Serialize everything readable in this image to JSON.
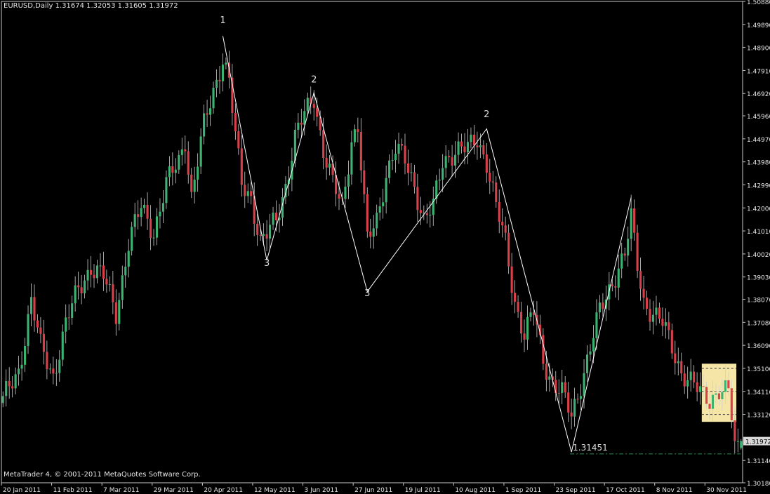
{
  "window": {
    "header": "EURUSD,Daily  1.31674 1.32053 1.31605 1.31972",
    "copyright": "MetaTrader 4, © 2001-2011 MetaQuotes Software Corp."
  },
  "colors": {
    "background": "#000000",
    "frame": "#c8c8c8",
    "text": "#e6e6e6",
    "bull_candle": "#3cb371",
    "bear_candle": "#d9404a",
    "wick": "#d0d0d0",
    "wave_line": "#ffffff",
    "highlight_box": "#f5e6a8",
    "support_line": "#2e8b57"
  },
  "chart_data": {
    "type": "candlestick",
    "symbol": "EURUSD",
    "timeframe": "Daily",
    "last_bar": {
      "open": 1.31674,
      "high": 1.32053,
      "low": 1.31605,
      "close": 1.31972
    },
    "current_price_label": "1.31972",
    "ylim": [
      1.3018,
      1.5088
    ],
    "y_ticks": [
      "1.50880",
      "1.49890",
      "1.48900",
      "1.47910",
      "1.46920",
      "1.45960",
      "1.44970",
      "1.43980",
      "1.42990",
      "1.42000",
      "1.41010",
      "1.40020",
      "1.39030",
      "1.38070",
      "1.37080",
      "1.36090",
      "1.35100",
      "1.34110",
      "1.33120",
      "1.31140",
      "1.30180"
    ],
    "x_ticks": [
      "20 Jan 2011",
      "11 Feb 2011",
      "7 Mar 2011",
      "29 Mar 2011",
      "20 Apr 2011",
      "12 May 2011",
      "3 Jun 2011",
      "27 Jun 2011",
      "19 Jul 2011",
      "10 Aug 2011",
      "1 Sep 2011",
      "23 Sep 2011",
      "17 Oct 2011",
      "8 Nov 2011",
      "30 Nov 2011"
    ],
    "x_tick_bar_index": [
      0,
      16,
      32,
      48,
      64,
      80,
      96,
      112,
      128,
      144,
      160,
      176,
      192,
      208,
      224
    ],
    "wave_lines": [
      {
        "points": [
          [
            70,
            1.4939
          ],
          [
            84,
            1.3975
          ],
          [
            99,
            1.4695
          ],
          [
            116,
            1.384
          ],
          [
            154,
            1.454
          ],
          [
            181,
            1.315
          ],
          [
            200,
            1.4245
          ]
        ]
      }
    ],
    "wave_labels": [
      {
        "text": "1",
        "bar": 70,
        "price": 1.4995
      },
      {
        "text": "2",
        "bar": 99,
        "price": 1.474
      },
      {
        "text": "3",
        "bar": 84,
        "price": 1.395
      },
      {
        "text": "3",
        "bar": 116,
        "price": 1.382
      },
      {
        "text": "2",
        "bar": 154,
        "price": 1.459
      }
    ],
    "low_annotation": {
      "text": "1.31451",
      "bar": 181,
      "price": 1.3145
    },
    "support_line_price": 1.3142,
    "highlight_zone": {
      "bar_from": 223,
      "bar_to": 233,
      "price_from": 1.328,
      "price_to": 1.353,
      "levels": [
        1.351,
        1.3411,
        1.3312
      ]
    },
    "candle_anchors": [
      [
        0,
        1.337
      ],
      [
        5,
        1.35
      ],
      [
        9,
        1.38
      ],
      [
        12,
        1.36
      ],
      [
        16,
        1.348
      ],
      [
        20,
        1.37
      ],
      [
        24,
        1.385
      ],
      [
        28,
        1.395
      ],
      [
        32,
        1.39
      ],
      [
        36,
        1.375
      ],
      [
        40,
        1.405
      ],
      [
        44,
        1.42
      ],
      [
        48,
        1.41
      ],
      [
        52,
        1.43
      ],
      [
        56,
        1.44
      ],
      [
        58,
        1.45
      ],
      [
        60,
        1.425
      ],
      [
        64,
        1.455
      ],
      [
        67,
        1.47
      ],
      [
        70,
        1.485
      ],
      [
        72,
        1.475
      ],
      [
        74,
        1.45
      ],
      [
        76,
        1.43
      ],
      [
        79,
        1.425
      ],
      [
        82,
        1.405
      ],
      [
        84,
        1.408
      ],
      [
        87,
        1.415
      ],
      [
        90,
        1.43
      ],
      [
        93,
        1.45
      ],
      [
        96,
        1.46
      ],
      [
        99,
        1.468
      ],
      [
        102,
        1.445
      ],
      [
        105,
        1.43
      ],
      [
        108,
        1.42
      ],
      [
        111,
        1.45
      ],
      [
        113,
        1.455
      ],
      [
        116,
        1.405
      ],
      [
        119,
        1.415
      ],
      [
        122,
        1.435
      ],
      [
        125,
        1.445
      ],
      [
        128,
        1.44
      ],
      [
        131,
        1.43
      ],
      [
        134,
        1.415
      ],
      [
        137,
        1.42
      ],
      [
        140,
        1.44
      ],
      [
        144,
        1.445
      ],
      [
        148,
        1.445
      ],
      [
        151,
        1.45
      ],
      [
        154,
        1.44
      ],
      [
        157,
        1.42
      ],
      [
        160,
        1.405
      ],
      [
        163,
        1.38
      ],
      [
        166,
        1.365
      ],
      [
        169,
        1.375
      ],
      [
        172,
        1.355
      ],
      [
        175,
        1.345
      ],
      [
        178,
        1.34
      ],
      [
        181,
        1.33
      ],
      [
        184,
        1.345
      ],
      [
        187,
        1.36
      ],
      [
        190,
        1.375
      ],
      [
        193,
        1.385
      ],
      [
        196,
        1.395
      ],
      [
        198,
        1.4
      ],
      [
        200,
        1.415
      ],
      [
        202,
        1.395
      ],
      [
        204,
        1.38
      ],
      [
        207,
        1.375
      ],
      [
        210,
        1.37
      ],
      [
        213,
        1.36
      ],
      [
        216,
        1.35
      ],
      [
        219,
        1.345
      ],
      [
        222,
        1.34
      ],
      [
        225,
        1.338
      ],
      [
        228,
        1.342
      ],
      [
        231,
        1.34
      ],
      [
        233,
        1.3197
      ]
    ]
  }
}
